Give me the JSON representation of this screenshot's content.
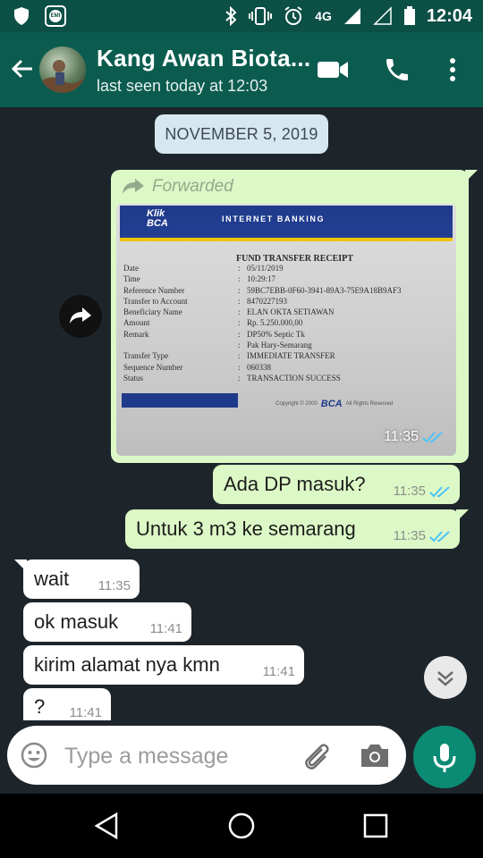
{
  "status_bar": {
    "network": "4G",
    "time": "12:04",
    "icons": [
      "shield-icon",
      "emi-icon",
      "bluetooth-icon",
      "vibrate-icon",
      "alarm-icon",
      "signal-icon",
      "signal-empty-icon",
      "battery-icon"
    ]
  },
  "header": {
    "contact_name": "Kang Awan Biota...",
    "status": "last seen today at 12:03",
    "icons": [
      "back-arrow-icon",
      "avatar",
      "video-call-icon",
      "phone-icon",
      "more-vert-icon"
    ]
  },
  "chat": {
    "date_chip": "NOVEMBER 5, 2019",
    "forwarded_message": {
      "label": "Forwarded",
      "time": "11:35",
      "status": "read",
      "receipt": {
        "logo_top": "Klik",
        "logo_bottom": "BCA",
        "header": "INTERNET BANKING",
        "title": "FUND TRANSFER RECEIPT",
        "rows": [
          {
            "label": "Date",
            "value": "05/11/2019"
          },
          {
            "label": "Time",
            "value": "10:29:17"
          },
          {
            "label": "Reference Number",
            "value": "59BC7EBB-0F60-3941-89A3-75E9A18B9AF3"
          },
          {
            "label": "Transfer to Account",
            "value": "8470227193"
          },
          {
            "label": "Beneficiary Name",
            "value": "ELAN OKTA SETIAWAN"
          },
          {
            "label": "Amount",
            "value": "Rp.     5.250.000,00"
          },
          {
            "label": "Remark",
            "value": "DP50% Septic Tk"
          },
          {
            "label": "",
            "value": "Pak Hary-Semarang"
          },
          {
            "label": "Transfer Type",
            "value": "IMMEDIATE TRANSFER"
          },
          {
            "label": "Sequence Number",
            "value": "060338"
          },
          {
            "label": "Status",
            "value": "TRANSACTION SUCCESS"
          }
        ],
        "footer_text": "Copyright © 2000",
        "footer_brand": "BCA",
        "footer_rights": "All Rights Reserved"
      }
    },
    "messages": [
      {
        "direction": "out",
        "text": "Ada DP masuk?",
        "time": "11:35",
        "status": "read"
      },
      {
        "direction": "out",
        "text": "Untuk 3 m3 ke semarang",
        "time": "11:35",
        "status": "read"
      },
      {
        "direction": "in",
        "text": "wait",
        "time": "11:35"
      },
      {
        "direction": "in",
        "text": "ok masuk",
        "time": "11:41"
      },
      {
        "direction": "in",
        "text": "kirim alamat nya kmn",
        "time": "11:41"
      },
      {
        "direction": "in",
        "text": "?",
        "time": "11:41"
      }
    ]
  },
  "input": {
    "placeholder": "Type a message",
    "icons": [
      "emoji-icon",
      "attach-icon",
      "camera-icon",
      "mic-icon"
    ]
  },
  "colors": {
    "header": "#0b5c4f",
    "status_bar": "#0b4f45",
    "outgoing_bubble": "#dcf8c6",
    "incoming_bubble": "#ffffff",
    "chat_background": "#1d252b",
    "read_ticks": "#4fc3f7",
    "mic_button": "#0b8a74"
  }
}
